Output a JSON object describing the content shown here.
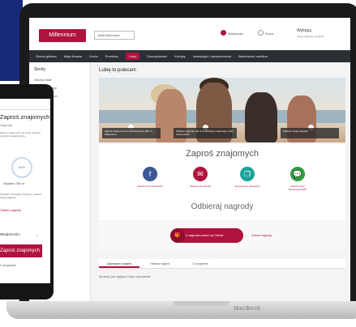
{
  "website": {
    "logo": "Millennium",
    "account_select": "Jakub Malinowski",
    "messages_label": "Wiadomości",
    "help_label": "Pomoc",
    "logout_label": "Wyloguj",
    "logout_sub": "Sesja wygaśnie za 09:59",
    "nav": [
      "Strona główna",
      "Moje finanse",
      "Konta",
      "Przelewy",
      "Karty",
      "Oszczędności",
      "Kredyty",
      "Inwestycje i ubezpieczenia",
      "Bankowość mobilna"
    ],
    "sidebar": {
      "title": "Skróty",
      "items": [
        "Zlecenia stałe",
        "Historia transakcji",
        "Zaproś znajomych",
        "Płatności",
        "Dokumenty"
      ],
      "link": "Szczegóły"
    },
    "main_title": "Lubię to polecam",
    "hero_captions": [
      "Zaproś znajomych do otwarcia konta 360° w Millennium",
      "Odbierz nagrodę 100 zł za każdego znajomego, który założy konto",
      "Odbierz swoją nagrodę"
    ],
    "invite_title": "Zaproś znajomych",
    "invite_channels": [
      {
        "label": "Zaproś przez Facebook",
        "icon": "facebook-icon",
        "glyph": "f",
        "color": "#3b5998"
      },
      {
        "label": "Zaproś przez Email",
        "icon": "email-icon",
        "glyph": "✉",
        "color": "#b0133e"
      },
      {
        "label": "Skopiuj link i udostępnij",
        "icon": "copy-link-icon",
        "glyph": "❐",
        "color": "#1aa39a"
      },
      {
        "label": "Zaproś przez Messenger/SMS",
        "icon": "chat-icon",
        "glyph": "💬",
        "color": "#2e9e3f"
      }
    ],
    "reward_title": "Odbieraj nagrody",
    "reward_count": "1",
    "reward_button": "nagroda czeka na Ciebie",
    "reward_link": "Zobacz nagrody",
    "tabs": [
      "Zaproszeni znajomi",
      "Historia nagród",
      "O programie"
    ],
    "tab_body": "Sprawdź, jak wygląda Twoje zaproszenie"
  },
  "phone": {
    "title": "Zaproś znajomych",
    "subtitle": "Nagrody",
    "text1": "Zaproś znajomych i otrzymaj nagrodę za każde otwarte konto",
    "ring_value": "50%",
    "earned": "Wydano 360 zł",
    "text2": "Sprawdź szczegóły programu i odbierz swoją nagrodę",
    "red_link": "Odbierz nagrodę",
    "section": "Wiadomości",
    "button": "Zaproś znajomych",
    "footer": "O programie"
  },
  "device_label": "MacBook",
  "colors": {
    "brand": "#b0133e",
    "nav": "#2d2f36",
    "corner": "#1a2a7a"
  }
}
